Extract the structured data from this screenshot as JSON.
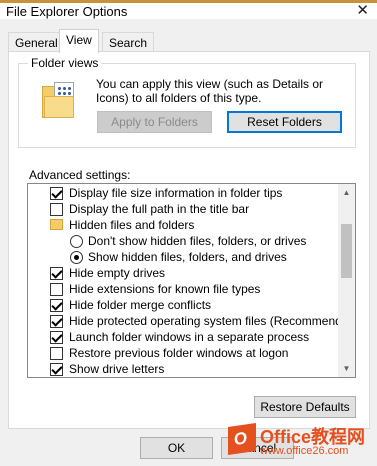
{
  "window": {
    "title": "File Explorer Options",
    "close_glyph": "✕"
  },
  "tabs": [
    {
      "label": "General"
    },
    {
      "label": "View"
    },
    {
      "label": "Search"
    }
  ],
  "folder_views": {
    "label": "Folder views",
    "description": "You can apply this view (such as Details or Icons) to all folders of this type.",
    "apply_label": "Apply to Folders",
    "reset_label": "Reset Folders"
  },
  "advanced": {
    "label": "Advanced settings:",
    "items": [
      {
        "label": "Display file size information in folder tips",
        "kind": "checkbox",
        "checked": true
      },
      {
        "label": "Display the full path in the title bar",
        "kind": "checkbox",
        "checked": false
      },
      {
        "label": "Hidden files and folders",
        "kind": "folder"
      },
      {
        "label": "Don't show hidden files, folders, or drives",
        "kind": "radio",
        "checked": false
      },
      {
        "label": "Show hidden files, folders, and drives",
        "kind": "radio",
        "checked": true
      },
      {
        "label": "Hide empty drives",
        "kind": "checkbox",
        "checked": true
      },
      {
        "label": "Hide extensions for known file types",
        "kind": "checkbox",
        "checked": false
      },
      {
        "label": "Hide folder merge conflicts",
        "kind": "checkbox",
        "checked": true
      },
      {
        "label": "Hide protected operating system files (Recommended)",
        "kind": "checkbox",
        "checked": true
      },
      {
        "label": "Launch folder windows in a separate process",
        "kind": "checkbox",
        "checked": true
      },
      {
        "label": "Restore previous folder windows at logon",
        "kind": "checkbox",
        "checked": false
      },
      {
        "label": "Show drive letters",
        "kind": "checkbox",
        "checked": true
      }
    ],
    "scroll_up_glyph": "▲",
    "scroll_down_glyph": "▼"
  },
  "restore_defaults_label": "Restore Defaults",
  "footer": {
    "ok_label": "OK",
    "cancel_label": "Cancel"
  },
  "watermark": {
    "logo_letter": "O",
    "text": "Office教程网",
    "url": "www.office26.com"
  }
}
